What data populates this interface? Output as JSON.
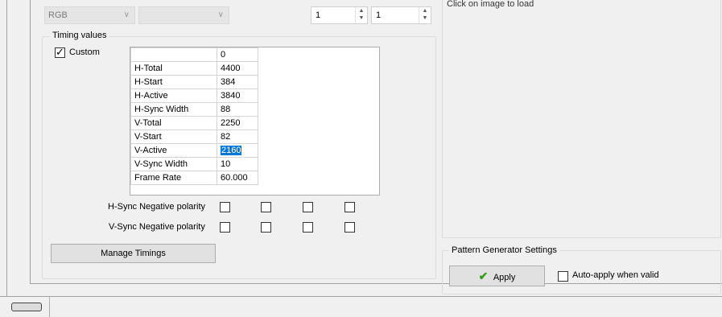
{
  "format_row": {
    "color_combo": "RGB",
    "second_combo": "",
    "spin1_value": "1",
    "spin2_value": "1"
  },
  "preview": {
    "hint": "Click on image to load"
  },
  "timing": {
    "group_title": "Timing values",
    "custom_label": "Custom",
    "custom_checked": true,
    "column_header": "0",
    "rows": [
      {
        "label": "H-Total",
        "value": "4400"
      },
      {
        "label": "H-Start",
        "value": "384"
      },
      {
        "label": "H-Active",
        "value": "3840"
      },
      {
        "label": "H-Sync Width",
        "value": "88"
      },
      {
        "label": "V-Total",
        "value": "2250"
      },
      {
        "label": "V-Start",
        "value": "82"
      },
      {
        "label": "V-Active",
        "value": "2160"
      },
      {
        "label": "V-Sync Width",
        "value": "10"
      },
      {
        "label": "Frame Rate",
        "value": "60.000"
      }
    ],
    "hsync_label": "H-Sync Negative polarity",
    "vsync_label": "V-Sync Negative polarity",
    "manage_button": "Manage Timings"
  },
  "pattern_gen": {
    "group_title": "Pattern Generator Settings",
    "apply_button": "Apply",
    "auto_apply_label": "Auto-apply when valid",
    "auto_apply_checked": false
  },
  "colors": {
    "selection": "#0078d7",
    "apply_check": "#3a9a1a"
  }
}
